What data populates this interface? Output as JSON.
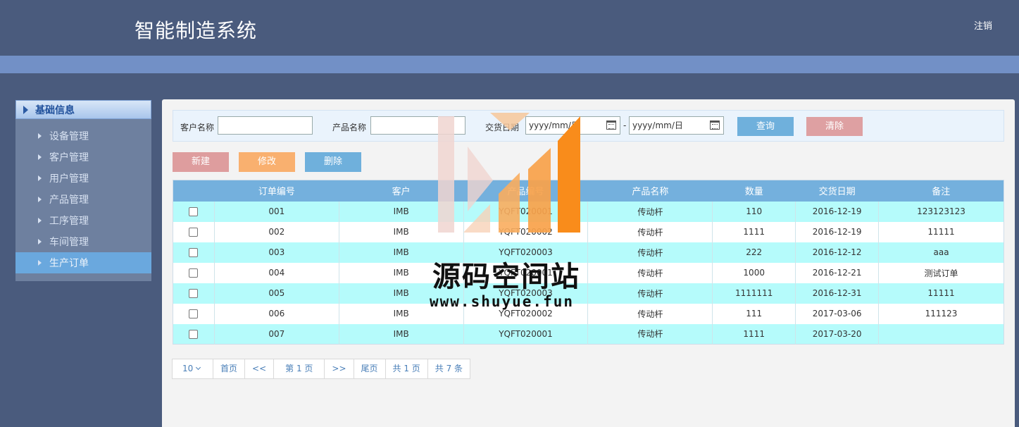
{
  "header": {
    "title": "智能制造系统",
    "logout": "注销"
  },
  "sidebar": {
    "section": "基础信息",
    "items": [
      {
        "label": "设备管理"
      },
      {
        "label": "客户管理"
      },
      {
        "label": "用户管理"
      },
      {
        "label": "产品管理"
      },
      {
        "label": "工序管理"
      },
      {
        "label": "车间管理"
      },
      {
        "label": "生产订单",
        "active": true
      }
    ]
  },
  "search": {
    "customer_label": "客户名称",
    "product_label": "产品名称",
    "date_label": "交货日期",
    "date_start": "yyyy/mm/日",
    "date_end": "yyyy/mm/日",
    "dash": "-",
    "query": "查询",
    "clear": "清除"
  },
  "toolbar": {
    "new": "新建",
    "edit": "修改",
    "delete": "删除"
  },
  "table": {
    "headers": [
      "",
      "订单编号",
      "客户",
      "产品编号",
      "产品名称",
      "数量",
      "交货日期",
      "备注"
    ],
    "rows": [
      [
        "001",
        "IMB",
        "YQFT020001",
        "传动杆",
        "110",
        "2016-12-19",
        "123123123"
      ],
      [
        "002",
        "IMB",
        "YQFT020002",
        "传动杆",
        "1111",
        "2016-12-19",
        "11111"
      ],
      [
        "003",
        "IMB",
        "YQFT020003",
        "传动杆",
        "222",
        "2016-12-12",
        "aaa"
      ],
      [
        "004",
        "IMB",
        "YQFT020001",
        "传动杆",
        "1000",
        "2016-12-21",
        "测试订单"
      ],
      [
        "005",
        "IMB",
        "YQFT020003",
        "传动杆",
        "1111111",
        "2016-12-31",
        "11111"
      ],
      [
        "006",
        "IMB",
        "YQFT020002",
        "传动杆",
        "111",
        "2017-03-06",
        "111123"
      ],
      [
        "007",
        "IMB",
        "YQFT020001",
        "传动杆",
        "1111",
        "2017-03-20",
        ""
      ]
    ]
  },
  "pager": {
    "page_size": "10",
    "first": "首页",
    "prev": "<<",
    "current": "第 1 页",
    "next": ">>",
    "last": "尾页",
    "total_pages": "共 1 页",
    "total_items": "共 7 条"
  },
  "watermark": {
    "name": "源码空间站",
    "url": "www.shuyue.fun"
  },
  "colors": {
    "header_bg": "#4a5b7d",
    "band": "#7290c6",
    "table_header": "#74b0dd",
    "row_alt": "#b5fbfb",
    "accent_orange": "#f98c1b"
  }
}
